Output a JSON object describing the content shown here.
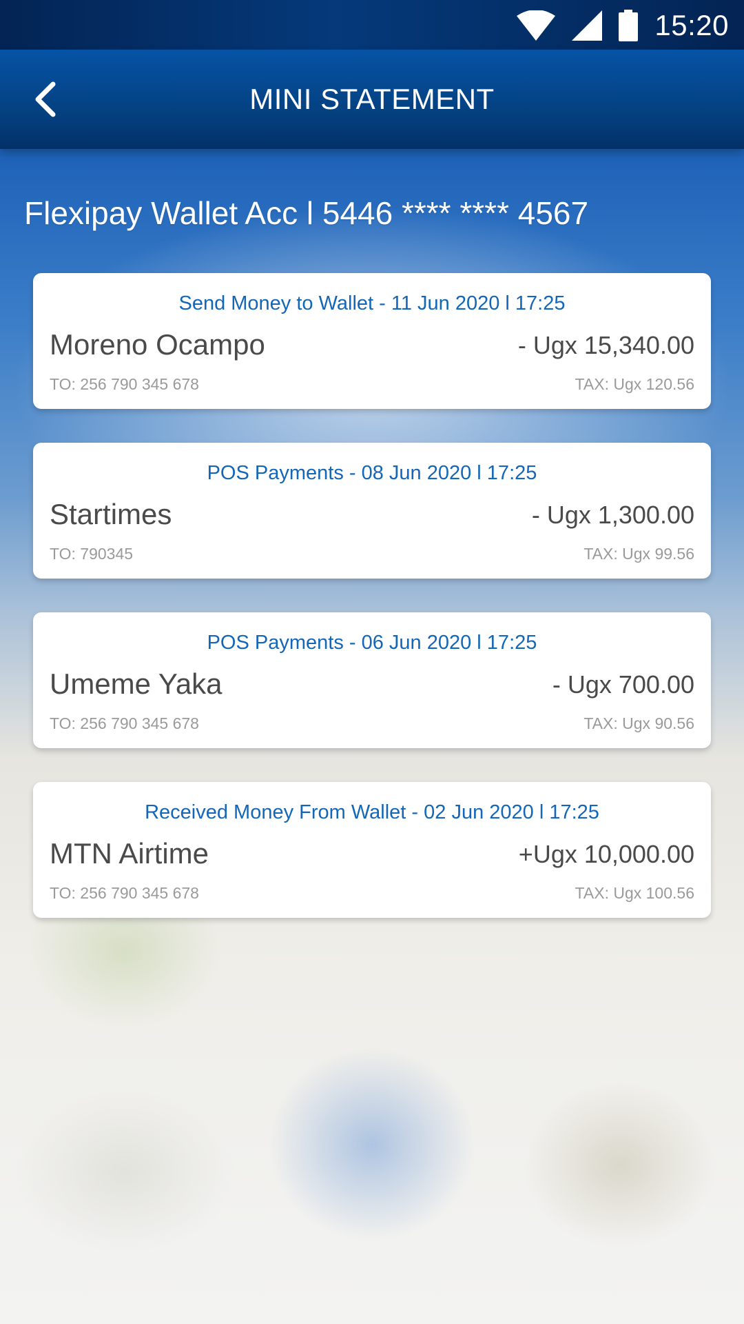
{
  "status_bar": {
    "time": "15:20",
    "icons": [
      "wifi-icon",
      "cellular-signal-icon",
      "battery-icon"
    ]
  },
  "app_bar": {
    "title": "MINI STATEMENT",
    "back_icon": "chevron-left-icon"
  },
  "account": {
    "label": "Flexipay Wallet Acc l 5446 **** **** 4567"
  },
  "transactions": [
    {
      "header": "Send Money to Wallet - 11 Jun 2020 l 17:25",
      "name": "Moreno Ocampo",
      "amount": "- Ugx 15,340.00",
      "to": "TO:  256 790 345 678",
      "tax": "TAX: Ugx 120.56"
    },
    {
      "header": "POS Payments - 08 Jun 2020 l 17:25",
      "name": "Startimes",
      "amount": "- Ugx 1,300.00",
      "to": "TO:  790345",
      "tax": "TAX: Ugx 99.56"
    },
    {
      "header": "POS Payments - 06 Jun 2020 l 17:25",
      "name": "Umeme Yaka",
      "amount": "- Ugx 700.00",
      "to": "TO:  256 790 345 678",
      "tax": "TAX: Ugx 90.56"
    },
    {
      "header": "Received Money From Wallet - 02 Jun 2020 l 17:25",
      "name": "MTN Airtime",
      "amount": "+Ugx 10,000.00",
      "to": "TO:  256 790 345 678",
      "tax": "TAX: Ugx 100.56"
    }
  ],
  "colors": {
    "app_bar": "#04407f",
    "status_bar": "#032454",
    "accent_text": "#1366b8",
    "primary_text": "#4a4a4a",
    "secondary_text": "#9a9a9a"
  }
}
